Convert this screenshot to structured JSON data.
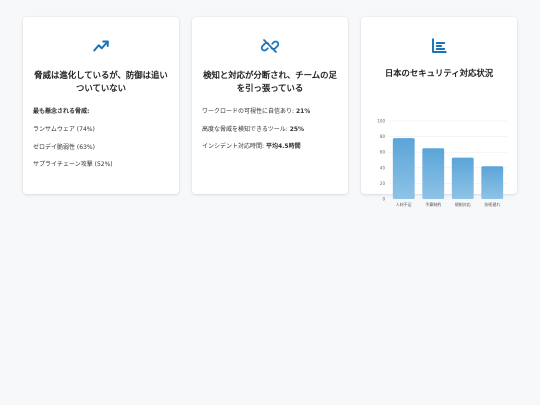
{
  "colors": {
    "accent": "#1a73b8",
    "bar_top": "#5ba4d8",
    "bar_bottom": "#8ec3e6",
    "grid": "#eeeeee",
    "background": "#f7f8fa"
  },
  "cards": [
    {
      "icon": "trending-up-icon",
      "title": "脅威は進化しているが、防御は追いついていない",
      "heading": "最も懸念される脅威:",
      "rows": [
        {
          "text": "ランサムウェア (74%)"
        },
        {
          "text": "ゼロデイ脆弱性 (63%)"
        },
        {
          "text": "サプライチェーン攻撃 (52%)"
        }
      ]
    },
    {
      "icon": "broken-link-icon",
      "title": "検知と対応が分断され、チームの足を引っ張っている",
      "rows": [
        {
          "label": "ワークロードの可視性に自信あり: ",
          "value": "21%"
        },
        {
          "label": "高度な脅威を検知できるツール: ",
          "value": "25%"
        },
        {
          "label": "インシデント対応時間: ",
          "value": "平均4.5時間"
        }
      ]
    },
    {
      "icon": "bar-chart-icon",
      "title": "日本のセキュリティ対応状況"
    }
  ],
  "chart_data": {
    "type": "bar",
    "categories": [
      "人材不足",
      "予算制約",
      "規制対応",
      "技術遅れ"
    ],
    "values": [
      78,
      65,
      53,
      42
    ],
    "ylim": [
      0,
      100
    ],
    "yticks": [
      "0",
      "20",
      "40",
      "60",
      "80",
      "100"
    ],
    "grid": true
  }
}
